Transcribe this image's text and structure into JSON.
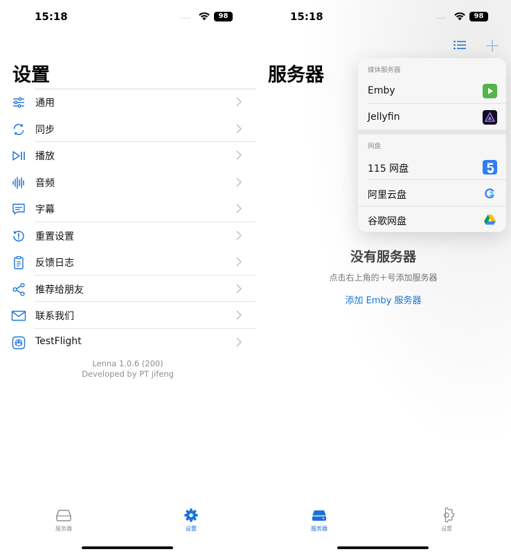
{
  "status": {
    "time": "15:18",
    "battery": "98",
    "signal_dots": "····"
  },
  "settings_screen": {
    "title": "设置",
    "items": [
      {
        "label": "通用",
        "icon": "sliders-icon"
      },
      {
        "label": "同步",
        "icon": "sync-icon"
      },
      {
        "label": "播放",
        "icon": "play-pause-icon"
      },
      {
        "label": "音频",
        "icon": "waveform-icon"
      },
      {
        "label": "字幕",
        "icon": "subtitle-icon"
      },
      {
        "label": "重置设置",
        "icon": "reset-icon"
      },
      {
        "label": "反馈日志",
        "icon": "clipboard-icon"
      },
      {
        "label": "推荐给朋友",
        "icon": "share-icon"
      },
      {
        "label": "联系我们",
        "icon": "mail-icon"
      },
      {
        "label": "TestFlight",
        "icon": "testflight-icon"
      }
    ],
    "version_line1": "Lenna 1.0.6 (200)",
    "version_line2": "Developed by PT jifeng"
  },
  "servers_screen": {
    "title": "服务器",
    "empty_title": "没有服务器",
    "empty_hint": "点击右上角的＋号添加服务器",
    "add_link": "添加 Emby 服务器",
    "menu": {
      "media_section": "媒体服务器",
      "media_items": [
        {
          "label": "Emby",
          "icon": "emby-icon"
        },
        {
          "label": "Jellyfin",
          "icon": "jellyfin-icon"
        }
      ],
      "disk_section": "网盘",
      "disk_items": [
        {
          "label": "115 网盘",
          "icon": "115-icon"
        },
        {
          "label": "阿里云盘",
          "icon": "aliyun-icon"
        },
        {
          "label": "谷歌网盘",
          "icon": "google-drive-icon"
        }
      ]
    }
  },
  "tabbar": {
    "servers_label": "服务器",
    "settings_label": "设置"
  },
  "colors": {
    "accent": "#1a73d9",
    "inactive": "#8e8e93"
  }
}
